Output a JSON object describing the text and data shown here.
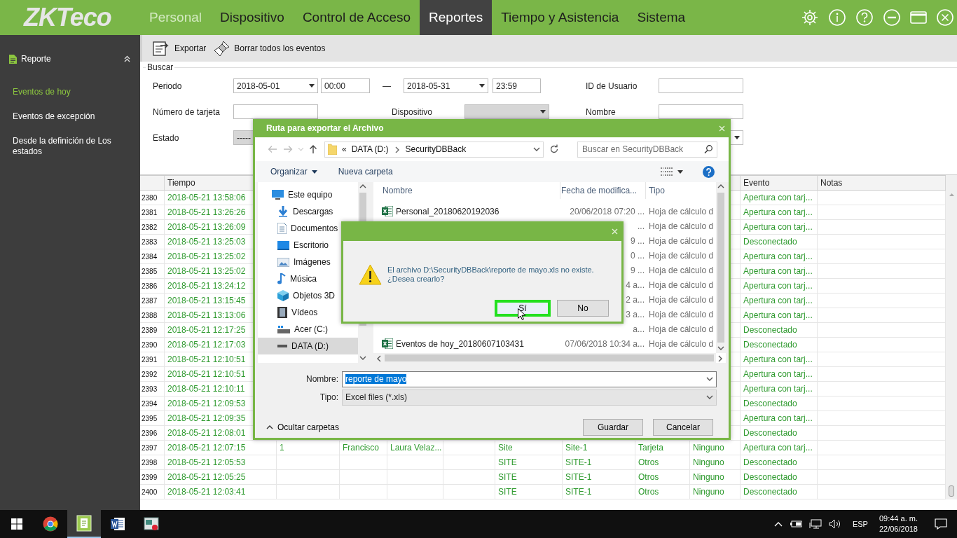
{
  "header": {
    "logo": "ZKTeco",
    "nav": [
      {
        "label": "Personal",
        "selected": false,
        "muted": true
      },
      {
        "label": "Dispositivo",
        "selected": false,
        "muted": false
      },
      {
        "label": "Control de Acceso",
        "selected": false,
        "muted": false
      },
      {
        "label": "Reportes",
        "selected": true,
        "muted": false
      },
      {
        "label": "Tiempo y Asistencia",
        "selected": false,
        "muted": false
      },
      {
        "label": "Sistema",
        "selected": false,
        "muted": false
      }
    ]
  },
  "sidebar": {
    "title": "Reporte",
    "expanded": true,
    "items": [
      {
        "label": "Eventos de hoy",
        "selected": true
      },
      {
        "label": "Eventos de excepción",
        "selected": false
      },
      {
        "label": "Desde la definición de Los estados",
        "selected": false
      }
    ]
  },
  "toolbar": [
    {
      "kind": "export",
      "label": "Exportar"
    },
    {
      "kind": "clear",
      "label": "Borrar todos los eventos"
    }
  ],
  "search": {
    "legend": "Buscar",
    "period_label": "Periodo",
    "start_date": "2018-05-01",
    "start_time": "00:00",
    "separator": "—",
    "end_date": "2018-05-31",
    "end_time": "23:59",
    "user_id_label": "ID de Usuario",
    "card_label": "Número de tarjeta",
    "device_label": "Dispositivo",
    "device_disabled": true,
    "name_label": "Nombre",
    "state_label": "Estado",
    "state_value": "-----"
  },
  "table": {
    "headers": {
      "time": "Tiempo",
      "event": "Evento",
      "notes": "Notas"
    },
    "rows": [
      {
        "index": "2380",
        "time": "2018-05-21 13:58:06",
        "event": "Apertura con tarj..."
      },
      {
        "index": "2381",
        "time": "2018-05-21 13:26:26",
        "event": "Apertura con tarj..."
      },
      {
        "index": "2382",
        "time": "2018-05-21 13:26:09",
        "event": "Apertura con tarj..."
      },
      {
        "index": "2383",
        "time": "2018-05-21 13:25:03",
        "event": "Desconectado"
      },
      {
        "index": "2384",
        "time": "2018-05-21 13:25:02",
        "event": "Apertura con tarj..."
      },
      {
        "index": "2385",
        "time": "2018-05-21 13:25:02",
        "event": "Apertura con tarj..."
      },
      {
        "index": "2386",
        "time": "2018-05-21 13:24:12",
        "event": "Apertura con tarj..."
      },
      {
        "index": "2387",
        "time": "2018-05-21 13:15:45",
        "event": "Apertura con tarj..."
      },
      {
        "index": "2388",
        "time": "2018-05-21 13:13:06",
        "event": "Apertura con tarj..."
      },
      {
        "index": "2389",
        "time": "2018-05-21 12:17:25",
        "event": "Desconectado"
      },
      {
        "index": "2390",
        "time": "2018-05-21 12:17:03",
        "event": "Desconectado"
      },
      {
        "index": "2391",
        "time": "2018-05-21 12:10:51",
        "event": "Apertura con tarj..."
      },
      {
        "index": "2392",
        "time": "2018-05-21 12:10:51",
        "event": "Apertura con tarj..."
      },
      {
        "index": "2393",
        "time": "2018-05-21 12:10:11",
        "event": "Apertura con tarj..."
      },
      {
        "index": "2394",
        "time": "2018-05-21 12:09:53",
        "event": "Desconectado"
      },
      {
        "index": "2395",
        "time": "2018-05-21 12:09:35",
        "event": "Apertura con tarj..."
      },
      {
        "index": "2396",
        "time": "2018-05-21 12:08:01",
        "event": "Desconectado"
      },
      {
        "index": "2397",
        "time": "2018-05-21 12:07:15",
        "column_3": "1",
        "column_4": "Francisco",
        "column_5": "Laura Velaz...",
        "column_7": "Site",
        "column_8": "Site-1",
        "column_9": "Tarjeta",
        "column_10": "Ninguno",
        "event": "Apertura con tarj..."
      },
      {
        "index": "2398",
        "time": "2018-05-21 12:05:53",
        "column_7": "SITE",
        "column_8": "SITE-1",
        "column_9": "Otros",
        "column_10": "Ninguno",
        "event": "Desconectado"
      },
      {
        "index": "2399",
        "time": "2018-05-21 12:05:25",
        "column_7": "SITE",
        "column_8": "SITE-1",
        "column_9": "Otros",
        "column_10": "Ninguno",
        "event": "Desconectado"
      },
      {
        "index": "2400",
        "time": "2018-05-21 12:03:41",
        "column_7": "SITE",
        "column_8": "SITE-1",
        "column_9": "Otros",
        "column_10": "Ninguno",
        "event": "Desconectado"
      }
    ]
  },
  "export_dialog": {
    "title": "Ruta para exportar el Archivo",
    "path_prefix": "«",
    "path": [
      "DATA (D:)",
      "SecurityDBBack"
    ],
    "search_placeholder": "Buscar en SecurityDBBack",
    "organize": "Organizar",
    "new_folder": "Nueva carpeta",
    "tree": [
      {
        "label": "Este equipo",
        "kind": "computer",
        "selected": false,
        "children": [
          {
            "label": "Descargas",
            "kind": "download",
            "selected": false
          },
          {
            "label": "Documentos",
            "kind": "documents",
            "selected": false
          },
          {
            "label": "Escritorio",
            "kind": "desktop",
            "selected": false
          },
          {
            "label": "Imágenes",
            "kind": "pictures",
            "selected": false
          },
          {
            "label": "Música",
            "kind": "music",
            "selected": false
          },
          {
            "label": "Objetos 3D",
            "kind": "objects",
            "selected": false
          },
          {
            "label": "Vídeos",
            "kind": "videos",
            "selected": false
          },
          {
            "label": "Acer (C:)",
            "kind": "system_drive",
            "selected": false
          },
          {
            "label": "DATA (D:)",
            "kind": "drive",
            "selected": true
          }
        ]
      }
    ],
    "columns": [
      "Nombre",
      "Fecha de modifica...",
      "Tipo"
    ],
    "files": [
      {
        "name": "Personal_20180620192036",
        "modified": "20/06/2018 07:20 ...",
        "type": "Hoja de cálculo d"
      },
      {
        "modified": "...",
        "type": "Hoja de cálculo d"
      },
      {
        "modified": "9 ...",
        "type": "Hoja de cálculo d"
      },
      {
        "modified": "0 ...",
        "type": "Hoja de cálculo d"
      },
      {
        "modified": "9 ...",
        "type": "Hoja de cálculo d"
      },
      {
        "modified": "4 a...",
        "type": "Hoja de cálculo d"
      },
      {
        "modified": "2 a...",
        "type": "Hoja de cálculo d"
      },
      {
        "modified": "3 a...",
        "type": "Hoja de cálculo d"
      },
      {
        "modified": "a...",
        "type": "Hoja de cálculo d"
      },
      {
        "name": "Eventos de hoy_20180607103431",
        "modified": "07/06/2018 10:34 a...",
        "type": "Hoja de cálculo d"
      }
    ],
    "name_label": "Nombre:",
    "name_value": "reporte de mayo",
    "name_selected": true,
    "type_label": "Tipo:",
    "type_value": "Excel files (*.xls)",
    "hide_folders": "Ocultar carpetas",
    "buttons": [
      "Guardar",
      "Cancelar"
    ]
  },
  "message_box": {
    "message": "El archivo D:\\SecurityDBBack\\reporte de mayo.xls no existe.\n¿Desea crearlo?",
    "buttons": [
      {
        "label": "Sí",
        "focused": true
      },
      {
        "label": "No",
        "focused": false
      }
    ]
  },
  "taskbar": {
    "apps": [
      {
        "kind": "browser",
        "active": false
      },
      {
        "kind": "report_app",
        "active": true
      },
      {
        "kind": "word_doc",
        "active": false
      },
      {
        "kind": "viewer",
        "active": false
      }
    ],
    "language": "ESP",
    "time": "09:44 a. m.",
    "date": "22/06/2018"
  }
}
